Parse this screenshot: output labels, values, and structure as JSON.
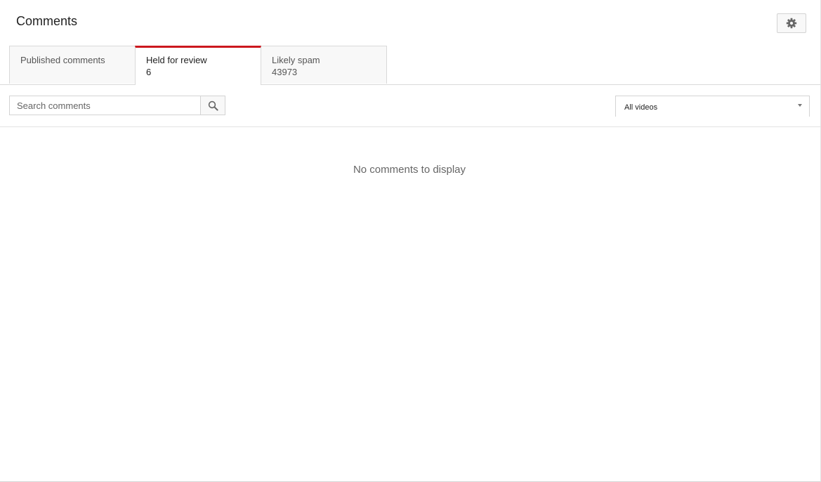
{
  "header": {
    "title": "Comments",
    "settings_icon": "gear-icon"
  },
  "tabs": [
    {
      "label": "Published comments",
      "count": "",
      "active": false
    },
    {
      "label": "Held for review",
      "count": "6",
      "active": true
    },
    {
      "label": "Likely spam",
      "count": "43973",
      "active": false
    }
  ],
  "search": {
    "placeholder": "Search comments",
    "value": "",
    "button_icon": "search-icon"
  },
  "video_filter": {
    "selected": "All videos",
    "icon": "chevron-down-icon"
  },
  "main": {
    "empty_message": "No comments to display"
  },
  "colors": {
    "active_tab_accent": "#cc181e",
    "tab_background": "#f8f8f8",
    "border": "#d9d9d9"
  }
}
